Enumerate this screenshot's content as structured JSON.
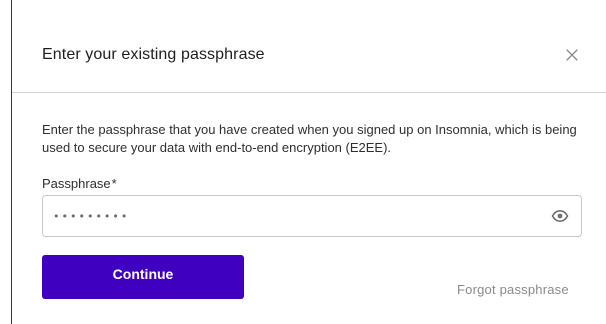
{
  "dialog": {
    "title": "Enter your existing passphrase",
    "close_icon": "close-icon",
    "description": "Enter the passphrase that you have created when you signed up on Insomnia, which is being used to secure your data with end-to-end encryption (E2EE).",
    "field": {
      "label": "Passphrase",
      "required_marker": "*",
      "value": "•••••••••",
      "toggle_icon": "eye-icon"
    },
    "continue_label": "Continue",
    "forgot_label": "Forgot passphrase"
  },
  "colors": {
    "primary_button": "#4000bf",
    "button_text": "#ffffff",
    "link": "#8a8a8a",
    "border": "#c9c9c9"
  }
}
